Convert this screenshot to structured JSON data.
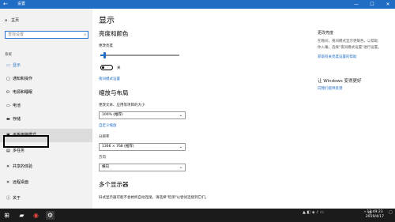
{
  "titlebar": {
    "back": "←",
    "title": "设置",
    "minimize": "—",
    "maximize": "☐",
    "close": "✕"
  },
  "sidebar": {
    "home_label": "主页",
    "search_placeholder": "查找设置",
    "section_label": "系统",
    "items": [
      {
        "label": "显示",
        "icon": "display-icon"
      },
      {
        "label": "通知和操作",
        "icon": "notification-icon"
      },
      {
        "label": "电源和睡眠",
        "icon": "power-icon"
      },
      {
        "label": "电池",
        "icon": "battery-icon"
      },
      {
        "label": "存储",
        "icon": "storage-icon"
      },
      {
        "label": "平板电脑模式",
        "icon": "tablet-icon"
      },
      {
        "label": "多任务",
        "icon": "multitask-icon"
      },
      {
        "label": "共享的体验",
        "icon": "share-icon"
      },
      {
        "label": "远程桌面",
        "icon": "remote-icon"
      },
      {
        "label": "关于",
        "icon": "info-icon"
      }
    ]
  },
  "content": {
    "page_title": "显示",
    "brightness_heading": "亮度和颜色",
    "brightness_label": "更改亮度",
    "brightness_level": 0.05,
    "night_light_state": "关",
    "night_light_link": "夜间模式设置",
    "scale_heading": "缩放与布局",
    "scale_label": "更改文本、应用等项目的大小",
    "scale_value": "100% (推荐)",
    "custom_scale_link": "自定义缩放",
    "resolution_label": "分辨率",
    "resolution_value": "1366 × 768 (推荐)",
    "orientation_label": "方向",
    "orientation_value": "横向",
    "multi_heading": "多个显示器",
    "multi_text": "旧式显示器可能不会始终自动连接。请选择\"检测\"以尝试连接到它们。"
  },
  "right_panel": {
    "help_heading": "更改亮度",
    "help_text_1": "在晚间，夜间模式显示更暖色，以帮助",
    "help_text_2": "你入睡。选择\"夜间模式设置\"进行设置。",
    "help_link": "获取有关亮度设置的帮助",
    "improve_heading": "让 Windows 变得更好",
    "feedback_link": "向我们提供反馈"
  },
  "taskbar": {
    "time": "13:49:23",
    "date": "2019/4/17",
    "tray_text": "^ 中"
  },
  "colors": {
    "accent": "#1f6dc4",
    "titlebar": "#1f6dc4",
    "taskbar": "#1b1b1b"
  }
}
